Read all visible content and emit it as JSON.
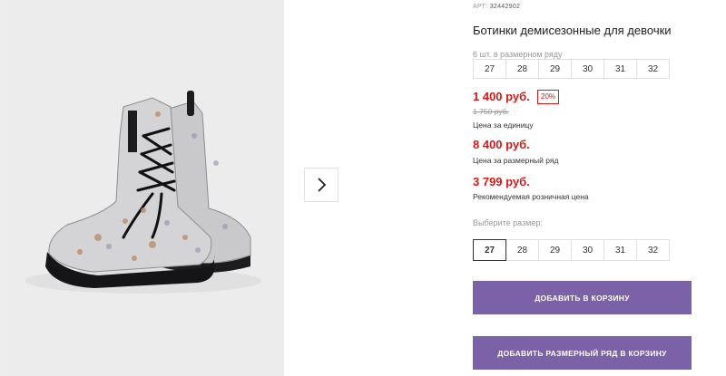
{
  "product": {
    "article_label": "АРТ:",
    "article_value": "32442902",
    "title": "Ботинки демисезонные для девочки",
    "pack_caption": "6 шт. в размерном ряду",
    "pack_sizes": [
      "27",
      "28",
      "29",
      "30",
      "31",
      "32"
    ]
  },
  "prices": {
    "unit_price": "1 400 руб.",
    "discount": "20%",
    "old_price": "1 750 руб.",
    "unit_note": "Цена за единицу",
    "pack_price": "8 400 руб.",
    "pack_note": "Цена за размерный ряд",
    "retail_price": "3 799 руб.",
    "retail_note": "Рекомендуемая розничная цена"
  },
  "size_picker": {
    "caption": "Выберите размер:",
    "sizes": [
      "27",
      "28",
      "29",
      "30",
      "31",
      "32"
    ],
    "selected": "27"
  },
  "buttons": {
    "add_to_cart": "ДОБАВИТЬ В КОРЗИНУ",
    "add_pack_to_cart": "ДОБАВИТЬ РАЗМЕРНЫЙ РЯД В КОРЗИНУ"
  },
  "gallery": {
    "image_icon": "boots-photo",
    "next_icon": "chevron-right-icon"
  },
  "colors": {
    "accent": "#7b62a8",
    "price_red": "#d31a1a"
  }
}
